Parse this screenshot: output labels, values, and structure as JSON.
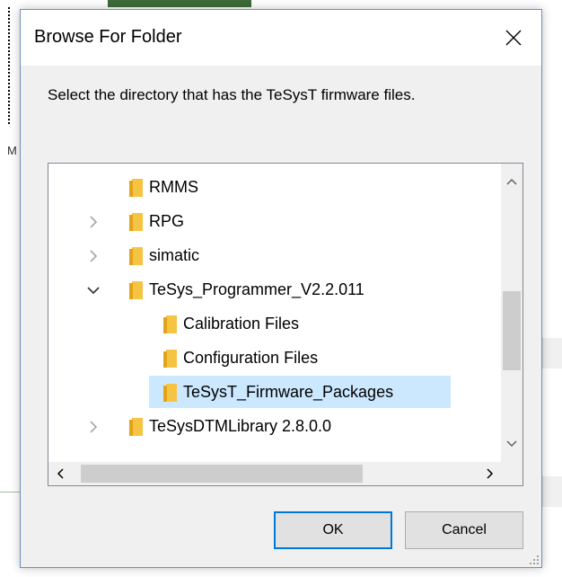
{
  "dialog": {
    "title": "Browse For Folder",
    "instruction": "Select the directory that has the TeSysT firmware files.",
    "ok_label": "OK",
    "cancel_label": "Cancel"
  },
  "background": {
    "side_letter": "M"
  },
  "tree": {
    "items": [
      {
        "label": "RMMS",
        "expander": "none",
        "selected": false
      },
      {
        "label": "RPG",
        "expander": "collapsed",
        "selected": false
      },
      {
        "label": "simatic",
        "expander": "collapsed",
        "selected": false
      },
      {
        "label": "TeSys_Programmer_V2.2.011",
        "expander": "expanded",
        "selected": false
      },
      {
        "label": "Calibration Files",
        "expander": "none",
        "selected": false
      },
      {
        "label": "Configuration Files",
        "expander": "none",
        "selected": false
      },
      {
        "label": "TeSysT_Firmware_Packages",
        "expander": "none",
        "selected": true
      },
      {
        "label": "TeSysDTMLibrary 2.8.0.0",
        "expander": "collapsed",
        "selected": false
      }
    ]
  },
  "colors": {
    "folder": "#f6c443",
    "selection": "#cce8ff",
    "accent": "#0078d7"
  }
}
